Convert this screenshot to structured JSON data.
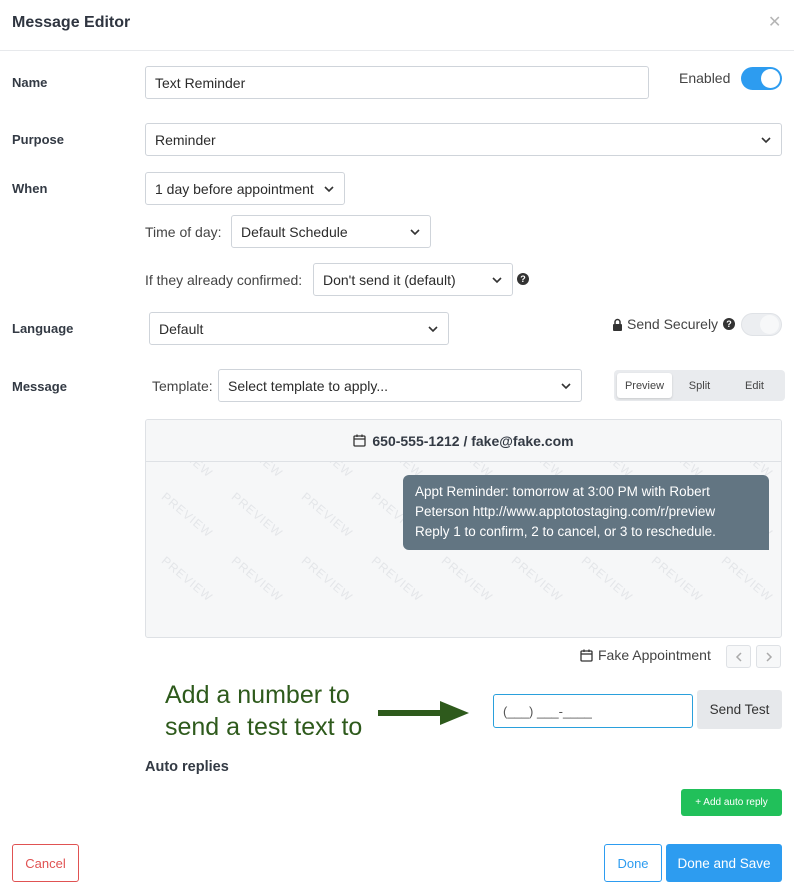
{
  "modal": {
    "title": "Message Editor",
    "close_icon": "close-icon"
  },
  "name": {
    "label": "Name",
    "value": "Text Reminder"
  },
  "enabled": {
    "label": "Enabled",
    "on": true
  },
  "purpose": {
    "label": "Purpose",
    "value": "Reminder"
  },
  "when": {
    "label": "When",
    "value": "1 day before appointment",
    "time_of_day": {
      "label": "Time of day:",
      "value": "Default Schedule"
    },
    "confirmed": {
      "label": "If they already confirmed:",
      "value": "Don't send it (default)"
    }
  },
  "language": {
    "label": "Language",
    "value": "Default"
  },
  "send_securely": {
    "label": "Send Securely",
    "on": false
  },
  "message": {
    "label": "Message",
    "template_label": "Template:",
    "template_placeholder": "Select template to apply...",
    "view_modes": [
      "Preview",
      "Split",
      "Edit"
    ],
    "active_view": "Preview"
  },
  "preview": {
    "contact": "650-555-1212 / fake@fake.com",
    "watermark": "PREVIEW",
    "bubble_lines": [
      "Appt Reminder: tomorrow at 3:00 PM with Robert",
      "Peterson http://www.apptotostaging.com/r/preview",
      "Reply 1 to confirm, 2 to cancel, or 3 to reschedule."
    ],
    "appointment_label": "Fake Appointment"
  },
  "annotation": {
    "line1": "Add a number to",
    "line2": "send a test text to"
  },
  "test": {
    "phone_placeholder": "(___) ___-____",
    "send_label": "Send Test"
  },
  "auto_replies": {
    "label": "Auto replies",
    "add_label": "+ Add auto reply"
  },
  "footer": {
    "cancel": "Cancel",
    "done": "Done",
    "done_save": "Done and Save"
  },
  "colors": {
    "primary": "#2d9cf0",
    "green": "#21c05a",
    "danger": "#e05252",
    "bubble": "#627582",
    "annotation": "#2e5a1c"
  }
}
